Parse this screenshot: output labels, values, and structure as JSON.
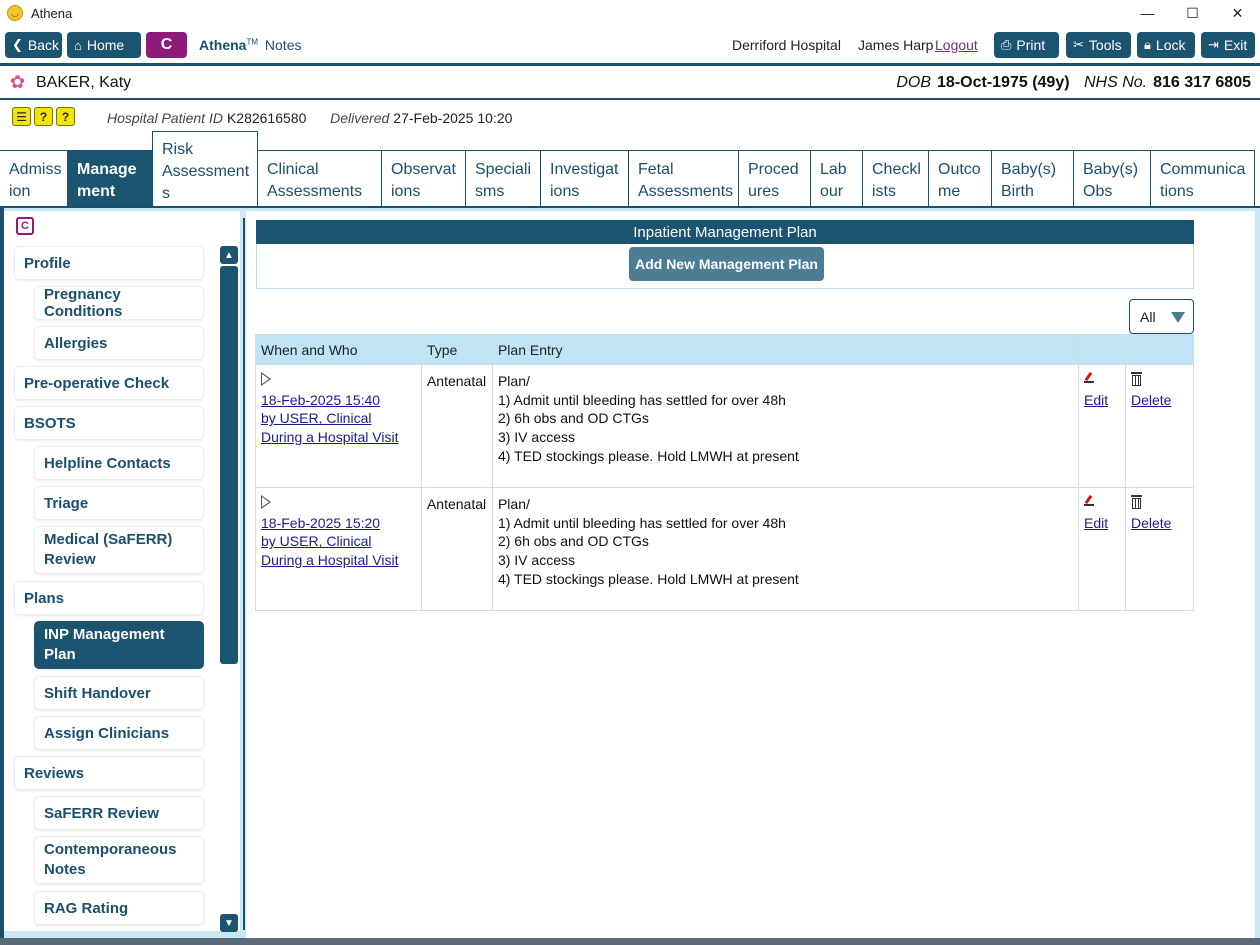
{
  "window": {
    "title": "Athena",
    "controls": {
      "minimize": "—",
      "maximize": "☐",
      "close": "✕"
    }
  },
  "toolbar": {
    "back_label": "Back",
    "home_label": "Home",
    "c_label": "C",
    "brand_name": "Athena",
    "brand_tm": "TM",
    "brand_suffix": "Notes",
    "hospital": "Derriford Hospital",
    "user": "James Harp",
    "logout_label": "Logout",
    "print_label": "Print",
    "tools_label": "Tools",
    "lock_label": "Lock",
    "exit_label": "Exit"
  },
  "patient": {
    "name": "BAKER, Katy",
    "dob_label": "DOB",
    "dob_value": "18-Oct-1975 (49y)",
    "nhs_label": "NHS No.",
    "nhs_value": "816 317 6805",
    "hpid_label": "Hospital Patient ID",
    "hpid_value": "K282616580",
    "delivered_label": "Delivered",
    "delivered_value": "27-Feb-2025 10:20",
    "alert_icons": [
      "alert-list-icon",
      "question-icon",
      "question-icon"
    ]
  },
  "tabs": [
    {
      "line1": "Admiss",
      "line2": "ion"
    },
    {
      "line1": "Manage",
      "line2": "ment"
    },
    {
      "line1": "Risk",
      "line2": "Assessment",
      "line3": "s"
    },
    {
      "line1": "Clinical",
      "line2": "Assessments"
    },
    {
      "line1": "Observat",
      "line2": "ions"
    },
    {
      "line1": "Speciali",
      "line2": "sms"
    },
    {
      "line1": "Investigat",
      "line2": "ions"
    },
    {
      "line1": "Fetal",
      "line2": "Assessments"
    },
    {
      "line1": "Proced",
      "line2": "ures"
    },
    {
      "line1": "Lab",
      "line2": "our"
    },
    {
      "line1": "Checkl",
      "line2": "ists"
    },
    {
      "line1": "Outco",
      "line2": "me"
    },
    {
      "line1": "Baby(s)",
      "line2": "Birth"
    },
    {
      "line1": "Baby(s)",
      "line2": "Obs"
    },
    {
      "line1": "Communica",
      "line2": "tions"
    }
  ],
  "sidebar": {
    "logo": "C",
    "items": [
      {
        "label": "Profile"
      },
      {
        "label": "Pregnancy Conditions"
      },
      {
        "label": "Allergies"
      },
      {
        "label": "Pre-operative Check"
      },
      {
        "label": "BSOTS"
      },
      {
        "label": "Helpline Contacts"
      },
      {
        "label": "Triage"
      },
      {
        "label": "Medical (SaFERR)",
        "label2": "Review"
      },
      {
        "label": "Plans"
      },
      {
        "label": "INP Management",
        "label2": "Plan"
      },
      {
        "label": "Shift Handover"
      },
      {
        "label": "Assign Clinicians"
      },
      {
        "label": "Reviews"
      },
      {
        "label": "SaFERR Review"
      },
      {
        "label": "Contemporaneous",
        "label2": "Notes"
      },
      {
        "label": "RAG Rating"
      }
    ]
  },
  "main": {
    "header": "Inpatient Management Plan",
    "add_button": "Add New Management Plan",
    "filter_value": "All",
    "columns": [
      "When and Who",
      "Type",
      "Plan Entry",
      "",
      ""
    ],
    "rows": [
      {
        "when_line1": "18-Feb-2025 15:40",
        "when_line2": "by USER, Clinical",
        "when_line3": "During a Hospital Visit",
        "type": "Antenatal",
        "entry": [
          "Plan/",
          "1) Admit until bleeding has settled for over 48h",
          "2) 6h obs and OD CTGs",
          "3) IV access",
          "4) TED stockings please. Hold LMWH at present"
        ],
        "edit_label": "Edit",
        "delete_label": "Delete"
      },
      {
        "when_line1": "18-Feb-2025 15:20",
        "when_line2": "by USER, Clinical",
        "when_line3": "During a Hospital Visit",
        "type": "Antenatal",
        "entry": [
          "Plan/",
          "1) Admit until bleeding has settled for over 48h",
          "2) 6h obs and OD CTGs",
          "3) IV access",
          "4) TED stockings please. Hold LMWH at present"
        ],
        "edit_label": "Edit",
        "delete_label": "Delete"
      }
    ]
  }
}
